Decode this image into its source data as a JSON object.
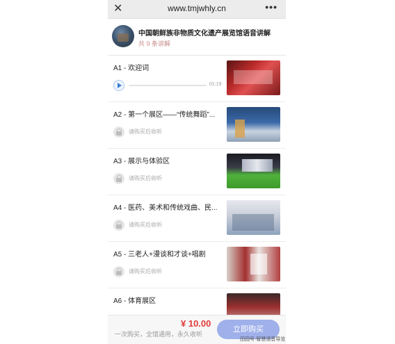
{
  "browser": {
    "url": "www.tmjwhly.cn",
    "close_icon": "close-icon",
    "more_icon": "more-icon"
  },
  "header": {
    "title": "中国朝鲜族非物质文化遗产展览馆语音讲解",
    "count_text": "共 9 条讲解"
  },
  "items": [
    {
      "label": "A1 - 欢迎词",
      "status": "playable",
      "duration": "01:19",
      "progress": 0
    },
    {
      "label": "A2 - 第一个展区——“传统舞蹈”...",
      "status": "locked",
      "lock_text": "请购买后收听"
    },
    {
      "label": "A3 - 展示与体验区",
      "status": "locked",
      "lock_text": "请购买后收听"
    },
    {
      "label": "A4 - 医药、美术和传统戏曲、民...",
      "status": "locked",
      "lock_text": "请购买后收听"
    },
    {
      "label": "A5 - 三老人+漫谈和才谈+唱剧",
      "status": "locked",
      "lock_text": "请购买后收听"
    },
    {
      "label": "A6 - 体育展区",
      "status": "locked"
    }
  ],
  "footer": {
    "text": "一次购买，全馆通用，永久收听",
    "price": "¥ 10.00",
    "buy_label": "立即购买"
  },
  "watermark": "田园号·智慧语音导览",
  "colors": {
    "accent": "#3b7fd4",
    "price": "#e23a3a",
    "buy_button": "#9fb0ea"
  }
}
